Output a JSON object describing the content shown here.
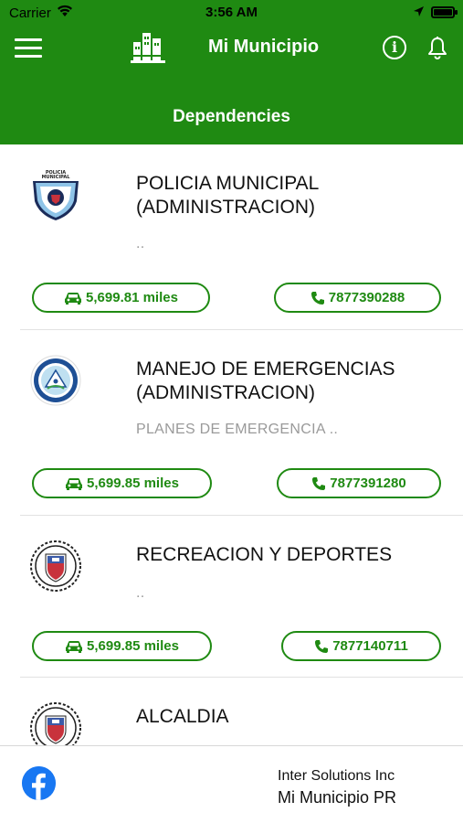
{
  "status_bar": {
    "carrier": "Carrier",
    "time": "3:56 AM"
  },
  "navbar": {
    "title": "Mi Municipio",
    "info_glyph": "i",
    "section_title": "Dependencies",
    "bar_color": "#1f8a12"
  },
  "dependencies": [
    {
      "name_line1": "POLICIA MUNICIPAL",
      "name_line2": "(ADMINISTRACION)",
      "description": "..",
      "distance": "5,699.81 miles",
      "phone": "7877390288",
      "seal_icon": "police-badge-icon"
    },
    {
      "name_line1": "MANEJO DE EMERGENCIAS",
      "name_line2": "(ADMINISTRACION)",
      "description": "PLANES DE EMERGENCIA ..",
      "distance": "5,699.85 miles",
      "phone": "7877391280",
      "seal_icon": "emergency-management-seal-icon"
    },
    {
      "name_line1": "RECREACION Y DEPORTES",
      "name_line2": "",
      "description": "..",
      "distance": "5,699.85 miles",
      "phone": "7877140711",
      "seal_icon": "municipal-seal-icon"
    },
    {
      "name_line1": "ALCALDIA",
      "name_line2": "",
      "description": "",
      "distance": "",
      "phone": "",
      "seal_icon": "municipal-seal-icon"
    }
  ],
  "footer": {
    "company": "Inter Solutions Inc",
    "app_name": "Mi Municipio PR",
    "social_icon": "facebook-icon"
  },
  "colors": {
    "accent": "#1f8a12",
    "description_text": "#9a9a9a",
    "facebook": "#1877f2"
  }
}
